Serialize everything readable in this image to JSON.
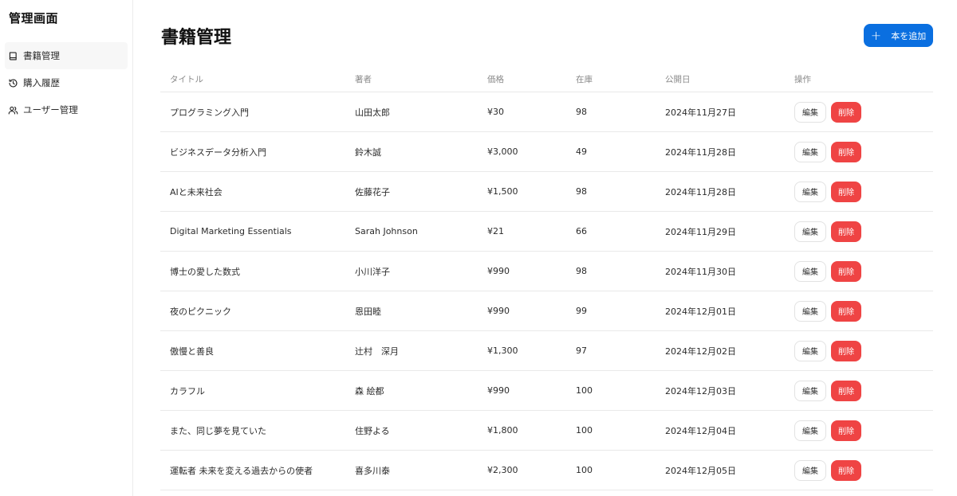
{
  "sidebar": {
    "title": "管理画面",
    "items": [
      {
        "label": "書籍管理",
        "icon": "book-icon"
      },
      {
        "label": "購入履歴",
        "icon": "history-icon"
      },
      {
        "label": "ユーザー管理",
        "icon": "users-icon"
      }
    ]
  },
  "main": {
    "title": "書籍管理",
    "add_button_label": "本を追加",
    "columns": [
      "タイトル",
      "著者",
      "価格",
      "在庫",
      "公開日",
      "操作"
    ],
    "edit_label": "編集",
    "delete_label": "削除",
    "rows": [
      {
        "title": "プログラミング入門",
        "author": "山田太郎",
        "price": "¥30",
        "stock": "98",
        "date": "2024年11月27日"
      },
      {
        "title": "ビジネスデータ分析入門",
        "author": "鈴木誠",
        "price": "¥3,000",
        "stock": "49",
        "date": "2024年11月28日"
      },
      {
        "title": "AIと未来社会",
        "author": "佐藤花子",
        "price": "¥1,500",
        "stock": "98",
        "date": "2024年11月28日"
      },
      {
        "title": "Digital Marketing Essentials",
        "author": "Sarah Johnson",
        "price": "¥21",
        "stock": "66",
        "date": "2024年11月29日"
      },
      {
        "title": "博士の愛した数式",
        "author": "小川洋子",
        "price": "¥990",
        "stock": "98",
        "date": "2024年11月30日"
      },
      {
        "title": "夜のピクニック",
        "author": "恩田睦",
        "price": "¥990",
        "stock": "99",
        "date": "2024年12月01日"
      },
      {
        "title": "傲慢と善良",
        "author": "辻村　深月",
        "price": "¥1,300",
        "stock": "97",
        "date": "2024年12月02日"
      },
      {
        "title": "カラフル",
        "author": "森 絵都",
        "price": "¥990",
        "stock": "100",
        "date": "2024年12月03日"
      },
      {
        "title": "また、同じ夢を見ていた",
        "author": "住野よる",
        "price": "¥1,800",
        "stock": "100",
        "date": "2024年12月04日"
      },
      {
        "title": "運転者 未来を変える過去からの使者",
        "author": "喜多川泰",
        "price": "¥2,300",
        "stock": "100",
        "date": "2024年12月05日"
      }
    ]
  },
  "colors": {
    "primary": "#0a6fe0",
    "danger": "#ef4444",
    "border": "#e9e9e9",
    "muted_text": "#8a8a8a"
  }
}
